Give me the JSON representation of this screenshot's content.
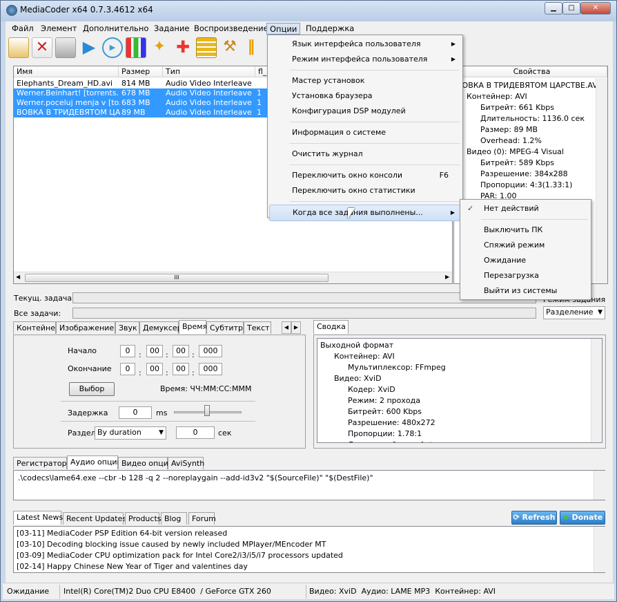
{
  "window": {
    "title": "MediaCoder x64 0.7.3.4612 x64",
    "minimize": "▁",
    "maximize": "□",
    "close": "✕"
  },
  "menu": [
    "Файл",
    "Элемент",
    "Дополнительно",
    "Задание",
    "Воспроизведение",
    "Опции",
    "Поддержка"
  ],
  "toolbar": [
    "add-file-icon",
    "remove-file-icon",
    "trash-icon",
    "play-icon",
    "preview-icon",
    "chart-icon",
    "wizard-icon",
    "puzzle-icon",
    "list-icon",
    "wrench-icon",
    "pause-icon"
  ],
  "filelist": {
    "headers": [
      "Имя",
      "Размер",
      "Тип",
      "fl_"
    ],
    "rows": [
      {
        "name": "Elephants_Dream_HD.avi",
        "size": "814 MB",
        "type": "Audio Video Interleave",
        "flag": "",
        "selected": false
      },
      {
        "name": "Werner.Beinhart! [torrents.",
        "size": "678 MB",
        "type": "Audio Video Interleave",
        "flag": "1",
        "selected": true
      },
      {
        "name": "Werner.poceluj menja v [to...",
        "size": "683 MB",
        "type": "Audio Video Interleave",
        "flag": "1",
        "selected": true
      },
      {
        "name": "ВОВКА В ТРИДЕВЯТОМ ЦА...",
        "size": "89 MB",
        "type": "Audio Video Interleave",
        "flag": "1",
        "selected": true
      }
    ],
    "hscroll": "III"
  },
  "properties": {
    "header": "Свойства",
    "lines": [
      "ВОВКА В ТРИДЕВЯТОМ ЦАРСТВЕ.AVI",
      "Контейнер: AVI",
      "Битрейт: 661 Kbps",
      "Длительность: 1136.0 сек",
      "Размер: 89 MB",
      "Overhead: 1.2%",
      "Видео (0): MPEG-4 Visual",
      "Битрейт: 589 Kbps",
      "Разрешение: 384x288",
      "Пропорции: 4:3(1.33:1)",
      "PAR: 1.00"
    ]
  },
  "status": {
    "current_label": "Текущ. задача:",
    "all_label": "Все задачи:",
    "post_label": "Режим задания",
    "post_value": "Разделение"
  },
  "left_tabs": [
    "Контейнер",
    "Изображение",
    "Звук",
    "Демуксер",
    "Время",
    "Субтитр",
    "Текст"
  ],
  "time": {
    "start": "Начало",
    "end": "Окончание",
    "start_vals": [
      "0",
      "00",
      "00",
      "000"
    ],
    "end_vals": [
      "0",
      "00",
      "00",
      "000"
    ],
    "select": "Выбор",
    "format": "Время: ЧЧ:ММ:СС:МММ",
    "delay": "Задержка",
    "delay_val": "0",
    "ms": "ms",
    "split": "Раздел",
    "split_mode": "By duration",
    "split_val": "0",
    "sec": "сек"
  },
  "summary": {
    "tab": "Сводка",
    "lines": [
      "Выходной формат",
      "Контейнер: AVI",
      "Мультиплексор: FFmpeg",
      "Видео: XviD",
      "Кодер: XviD",
      "Режим: 2 прохода",
      "Битрейт: 600 Kbps",
      "Разрешение: 480x272",
      "Пропорции: 1.78:1",
      "Деинтерлейсинг: Auto"
    ]
  },
  "cmd_tabs": [
    "Регистратор",
    "Аудио опции",
    "Видео опции",
    "AviSynth"
  ],
  "cmd_text": ".\\codecs\\lame64.exe --cbr -b 128 -q 2 --noreplaygain --add-id3v2 \"$(SourceFile)\" \"$(DestFile)\"",
  "news_tabs": [
    "Latest News",
    "Recent Updates",
    "Products",
    "Blog",
    "Forum"
  ],
  "refresh": "Refresh",
  "donate": "Donate",
  "news": [
    "[03-11] MediaCoder PSP Edition 64-bit version released",
    "[03-10] Decoding blocking issue caused by newly included MPlayer/MEncoder MT",
    "[03-09] MediaCoder CPU optimization pack for Intel Core2/i3/i5/i7 processors updated",
    "[02-14] Happy Chinese New Year of Tiger and valentines day"
  ],
  "statusbar": [
    "Ожидание",
    "Intel(R) Core(TM)2 Duo CPU E8400  / GeForce GTX 260",
    "Видео: XviD  Аудио: LAME MP3  Контейнер: AVI"
  ],
  "options_menu": {
    "items": [
      {
        "label": "Язык интерфейса пользователя",
        "sub": true
      },
      {
        "label": "Режим интерфейса пользователя",
        "sub": true
      },
      {
        "sep": true
      },
      {
        "label": "Мастер установок"
      },
      {
        "label": "Установка браузера"
      },
      {
        "label": "Конфигурация DSP модулей"
      },
      {
        "sep": true
      },
      {
        "label": "Информация о системе"
      },
      {
        "sep": true
      },
      {
        "label": "Очистить журнал"
      },
      {
        "sep": true
      },
      {
        "label": "Переключить окно консоли",
        "shortcut": "F6"
      },
      {
        "label": "Переключить окно статистики"
      },
      {
        "sep": true
      },
      {
        "label": "Когда все задания выполнены...",
        "sub": true,
        "hl": true
      }
    ]
  },
  "submenu": {
    "check": "✓",
    "items": [
      "Нет действий",
      "Выключить ПК",
      "Спяжий режим",
      "Ожидание",
      "Перезагрузка",
      "Выйти из системы"
    ]
  }
}
